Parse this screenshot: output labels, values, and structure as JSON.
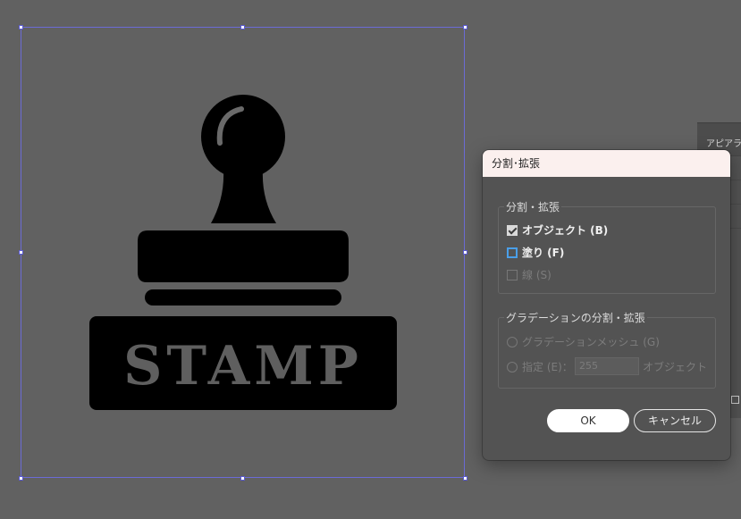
{
  "artwork": {
    "stamp_text": "STAMP",
    "colors": {
      "canvas": "#616161",
      "ink": "#000000",
      "text": "#5f5f5f",
      "selection": "#6b6bd6"
    }
  },
  "side_panel": {
    "tab_label": "アピアランス"
  },
  "dialog": {
    "title": "分割･拡張",
    "group1": {
      "legend": "分割・拡張",
      "options": [
        {
          "label": "オブジェクト (B)",
          "checked": true,
          "enabled": true
        },
        {
          "label": "塗り (F)",
          "checked": false,
          "enabled": true
        },
        {
          "label": "線 (S)",
          "checked": false,
          "enabled": false
        }
      ]
    },
    "group2": {
      "legend": "グラデーションの分割・拡張",
      "radio_mesh": "グラデーションメッシュ (G)",
      "radio_specify": "指定 (E)：",
      "specify_value": "255",
      "specify_unit": "オブジェクト"
    },
    "ok_label": "OK",
    "cancel_label": "キャンセル"
  }
}
